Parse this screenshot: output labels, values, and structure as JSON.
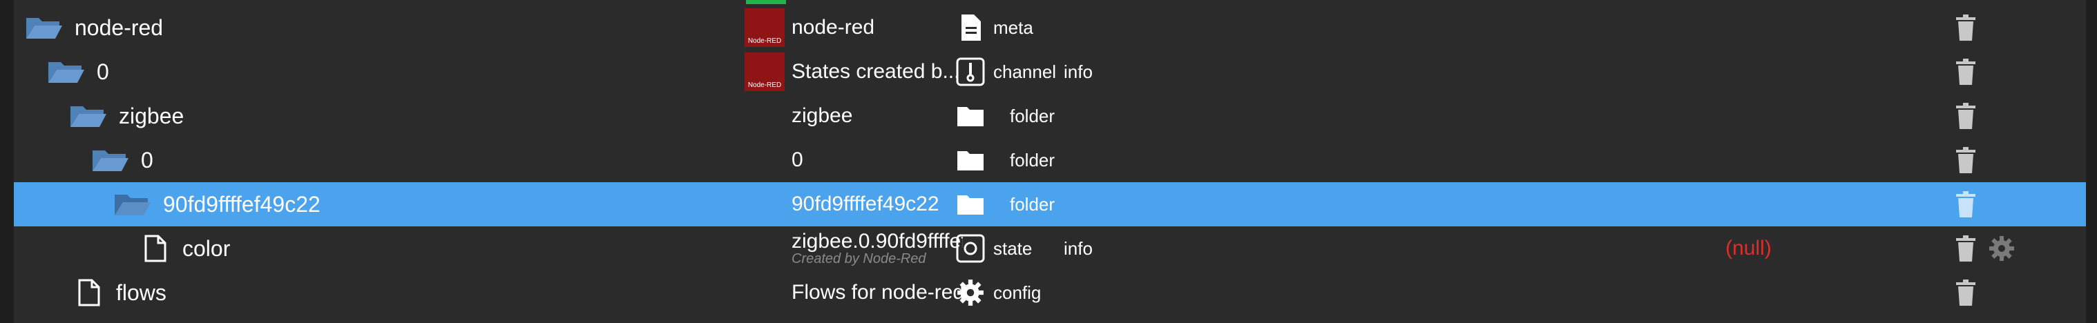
{
  "colors": {
    "background": "#2b2b2b",
    "selected_row": "#4aa3ec",
    "folder_blue": "#4f82b8",
    "null_red": "#d9302c",
    "adapter_logo_red": "#8f1416",
    "status_green": "#22b14c"
  },
  "rows": [
    {
      "tree_label": "node-red",
      "name": "node-red",
      "type": "meta",
      "role": "",
      "icon": "folder-open-icon",
      "type_icon": "document-icon",
      "has_logo": true
    },
    {
      "tree_label": "0",
      "name": "States created b...",
      "type": "channel",
      "role": "info",
      "icon": "folder-open-icon",
      "type_icon": "channel-icon",
      "has_logo": true
    },
    {
      "tree_label": "zigbee",
      "name": "zigbee",
      "type": "folder",
      "role": "",
      "icon": "folder-open-icon",
      "type_icon": "folder-icon"
    },
    {
      "tree_label": "0",
      "name": "0",
      "type": "folder",
      "role": "",
      "icon": "folder-open-icon",
      "type_icon": "folder-icon"
    },
    {
      "tree_label": "90fd9ffffef49c22",
      "name": "90fd9ffffef49c22",
      "type": "folder",
      "role": "",
      "icon": "folder-open-icon",
      "type_icon": "folder-icon",
      "selected": true
    },
    {
      "tree_label": "color",
      "name": "zigbee.0.90fd9ffffef",
      "subtitle": "Created by Node-Red",
      "type": "state",
      "role": "info",
      "value": "(null)",
      "icon": "file-icon",
      "type_icon": "state-icon"
    },
    {
      "tree_label": "flows",
      "name": "Flows for node-red",
      "type": "config",
      "role": "",
      "icon": "file-icon",
      "type_icon": "gear-icon"
    }
  ],
  "logo_text": "Node-RED"
}
